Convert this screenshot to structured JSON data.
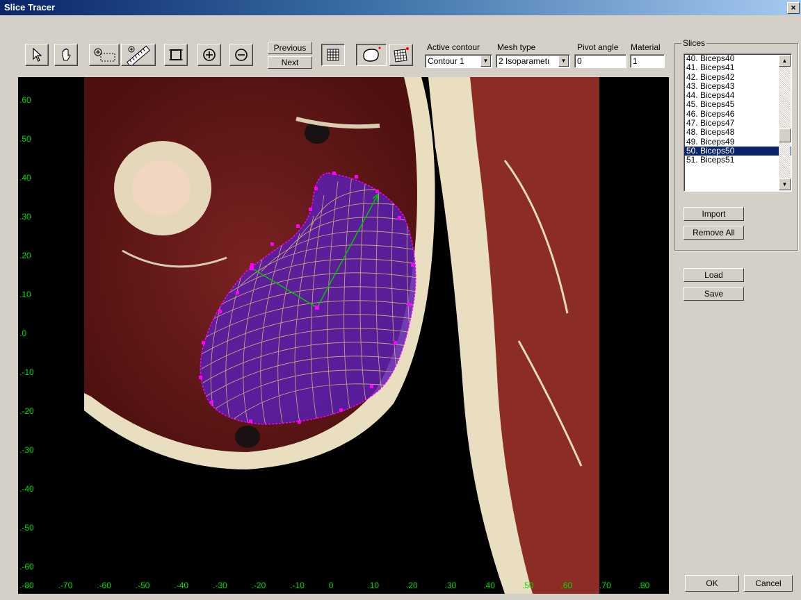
{
  "window": {
    "title": "Slice Tracer",
    "close_glyph": "×"
  },
  "toolbar": {
    "previous_label": "Previous",
    "next_label": "Next",
    "active_contour_label": "Active contour",
    "active_contour_value": "Contour 1",
    "mesh_type_label": "Mesh type",
    "mesh_type_value": "2 Isoparametı",
    "pivot_angle_label": "Pivot angle",
    "pivot_angle_value": "0",
    "material_label": "Material",
    "material_value": "1",
    "icons": [
      "pointer-icon",
      "hand-pan-icon",
      "zoom-box-icon",
      "ruler-icon",
      "fit-view-icon",
      "zoom-in-icon",
      "zoom-out-icon",
      "grid-icon",
      "contour-icon",
      "mesh-icon"
    ]
  },
  "slices": {
    "group_label": "Slices",
    "items": [
      "40. Biceps40",
      "41. Biceps41",
      "42. Biceps42",
      "43. Biceps43",
      "44. Biceps44",
      "45. Biceps45",
      "46. Biceps46",
      "47. Biceps47",
      "48. Biceps48",
      "49. Biceps49",
      "50. Biceps50",
      "51. Biceps51"
    ],
    "selected_index": 10,
    "import_label": "Import",
    "remove_all_label": "Remove All"
  },
  "file": {
    "load_label": "Load",
    "save_label": "Save"
  },
  "dialog": {
    "ok_label": "OK",
    "cancel_label": "Cancel"
  },
  "viewport": {
    "y_axis_labels": [
      ".60",
      ".50",
      ".40",
      ".30",
      ".20",
      ".10",
      ".0",
      ".-10",
      ".-20",
      ".-30",
      ".-40",
      ".-50",
      ".-60"
    ],
    "x_axis_labels": [
      ".-80",
      ".-70",
      ".-60",
      ".-50",
      ".-40",
      ".-30",
      ".-20",
      ".-10",
      "0",
      ".10",
      ".20",
      ".30",
      ".40",
      ".50",
      ".60",
      ".70",
      ".80"
    ],
    "colors": {
      "axis": "#00e000",
      "contour": "#ff00ff",
      "mesh_fill": "#5a1fb0",
      "mesh_lines": "#d8c27a",
      "pivot": "#00c000",
      "selection": "#0a246a"
    }
  }
}
